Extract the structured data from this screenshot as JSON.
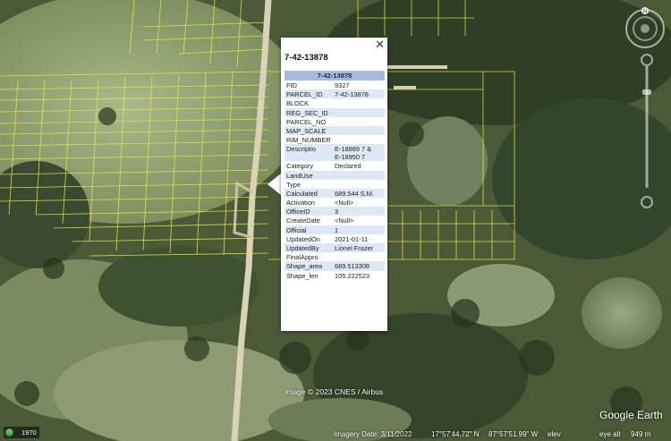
{
  "popup": {
    "title": "7-42-13878",
    "close_icon": "close-icon",
    "table_header": "7-42-13878",
    "rows": [
      {
        "key": "FID",
        "value": "9327"
      },
      {
        "key": "PARCEL_ID",
        "value": "7-42-13878"
      },
      {
        "key": "BLOCK",
        "value": ""
      },
      {
        "key": "REG_SEC_ID",
        "value": ""
      },
      {
        "key": "PARCEL_NO",
        "value": ""
      },
      {
        "key": "MAP_SCALE",
        "value": ""
      },
      {
        "key": "RIM_NUMBER",
        "value": ""
      },
      {
        "key": "Descriptio",
        "value": "E-18889 7 &",
        "value2": "E-18950 7"
      },
      {
        "key": "Category",
        "value": "Declared"
      },
      {
        "key": "LandUse",
        "value": ""
      },
      {
        "key": "Type",
        "value": ""
      },
      {
        "key": "Calculated",
        "value": "689.544 S.M."
      },
      {
        "key": "Activation",
        "value": "<Null>"
      },
      {
        "key": "OfficeID",
        "value": "3"
      },
      {
        "key": "CreateDate",
        "value": "<Null>"
      },
      {
        "key": "Official",
        "value": "1"
      },
      {
        "key": "UpdatedOn",
        "value": "2021-01-11"
      },
      {
        "key": "UpdatedBy",
        "value": "Lionel Frazer"
      },
      {
        "key": "FinalAppro",
        "value": ""
      },
      {
        "key": "Shape_area",
        "value": "689.513308"
      },
      {
        "key": "Shape_len",
        "value": "105.222523"
      }
    ]
  },
  "map": {
    "image_credit": "Image © 2023 CNES / Airbus",
    "logo": "Google Earth",
    "compass_label": "N",
    "parcel_line_color": "#e8e845"
  },
  "historical": {
    "year": "1970",
    "icon": "clock-icon"
  },
  "status": {
    "imagery_date": "Imagery Date: 3/11/2022",
    "lat": "17°57'44.72\" N",
    "lon": "87°57'51.99\" W",
    "elev": "elev",
    "eye_alt": "eye alt",
    "eye_alt_value": "949 m"
  }
}
